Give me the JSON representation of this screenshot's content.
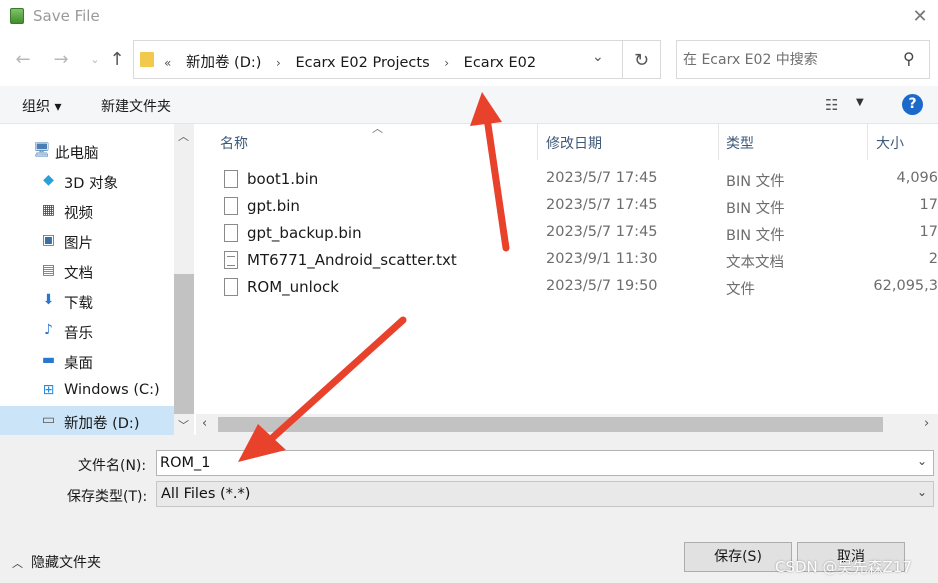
{
  "window": {
    "title": "Save File"
  },
  "address": {
    "crumbs": [
      "新加卷 (D:)",
      "Ecarx E02 Projects",
      "Ecarx E02"
    ],
    "overflow": "«"
  },
  "search": {
    "placeholder": "在 Ecarx E02 中搜索"
  },
  "toolbar": {
    "organize": "组织 ▾",
    "new_folder": "新建文件夹",
    "help": "?"
  },
  "nav": {
    "items": [
      {
        "label": "此电脑",
        "icon": "computer-icon"
      },
      {
        "label": "3D 对象",
        "icon": "3d-objects-icon"
      },
      {
        "label": "视频",
        "icon": "video-icon"
      },
      {
        "label": "图片",
        "icon": "pictures-icon"
      },
      {
        "label": "文档",
        "icon": "documents-icon"
      },
      {
        "label": "下载",
        "icon": "download-icon"
      },
      {
        "label": "音乐",
        "icon": "music-icon"
      },
      {
        "label": "桌面",
        "icon": "desktop-icon"
      },
      {
        "label": "Windows (C:)",
        "icon": "drive-c-icon"
      },
      {
        "label": "新加卷 (D:)",
        "icon": "drive-d-icon",
        "selected": true
      }
    ]
  },
  "columns": {
    "name": "名称",
    "modified": "修改日期",
    "type": "类型",
    "size": "大小"
  },
  "files": [
    {
      "name": "boot1.bin",
      "modified": "2023/5/7 17:45",
      "type": "BIN 文件",
      "size": "4,096"
    },
    {
      "name": "gpt.bin",
      "modified": "2023/5/7 17:45",
      "type": "BIN 文件",
      "size": "17"
    },
    {
      "name": "gpt_backup.bin",
      "modified": "2023/5/7 17:45",
      "type": "BIN 文件",
      "size": "17"
    },
    {
      "name": "MT6771_Android_scatter.txt",
      "modified": "2023/9/1 11:30",
      "type": "文本文档",
      "size": "2"
    },
    {
      "name": "ROM_unlock",
      "modified": "2023/5/7 19:50",
      "type": "文件",
      "size": "62,095,3"
    }
  ],
  "form": {
    "filename_label": "文件名(N):",
    "filename_value": "ROM_1",
    "filetype_label": "保存类型(T):",
    "filetype_value": "All Files (*.*)"
  },
  "footer": {
    "hide_folders": "隐藏文件夹",
    "save": "保存(S)",
    "cancel": "取消",
    "watermark": "CSDN @吴先森Z17"
  },
  "colors": {
    "annotation_arrow": "#e8412c",
    "selection": "#cce4f7",
    "help": "#1b6ac9"
  }
}
